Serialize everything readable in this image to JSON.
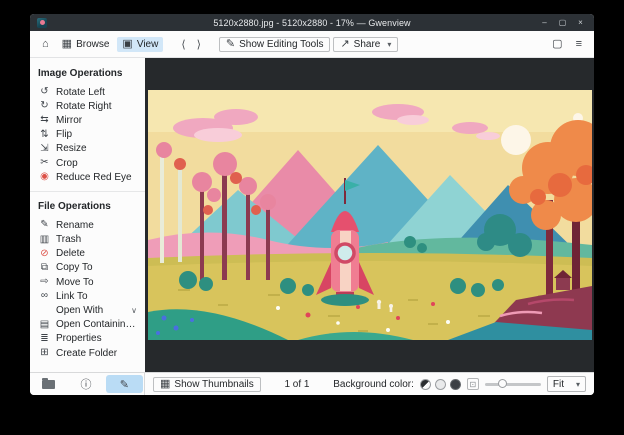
{
  "window": {
    "title": "5120x2880.jpg - 5120x2880 - 17% — Gwenview"
  },
  "icons": {
    "home": "⌂",
    "browse": "▦",
    "view": "▣",
    "back": "⟨",
    "forward": "⟩",
    "pencil": "✎",
    "share": "↗",
    "chevron_down": "▾",
    "fit_frame": "▢",
    "menu": "≡",
    "minimize": "–",
    "maximize": "▢",
    "close": "×",
    "rotate_left": "↺",
    "rotate_right": "↻",
    "mirror": "⇆",
    "flip": "⇅",
    "resize": "⇲",
    "crop": "✂",
    "red_eye": "◉",
    "rename": "✎",
    "trash": "▥",
    "delete": "⊘",
    "copy": "⧉",
    "move": "⇨",
    "link": "∞",
    "folder_open": "▤",
    "properties": "≣",
    "new_folder": "⊞",
    "expander": "∨",
    "info": "ⓘ",
    "thumbnails": "▦",
    "zoom_box": "⊡"
  },
  "toolbar": {
    "browse": "Browse",
    "view": "View",
    "show_editing_tools": "Show Editing Tools",
    "share": "Share"
  },
  "sidebar": {
    "image_operations": {
      "title": "Image Operations",
      "items": [
        {
          "label": "Rotate Left"
        },
        {
          "label": "Rotate Right"
        },
        {
          "label": "Mirror"
        },
        {
          "label": "Flip"
        },
        {
          "label": "Resize"
        },
        {
          "label": "Crop"
        },
        {
          "label": "Reduce Red Eye"
        }
      ]
    },
    "file_operations": {
      "title": "File Operations",
      "items": [
        {
          "label": "Rename"
        },
        {
          "label": "Trash"
        },
        {
          "label": "Delete"
        },
        {
          "label": "Copy To"
        },
        {
          "label": "Move To"
        },
        {
          "label": "Link To"
        },
        {
          "label": "Open With"
        },
        {
          "label": "Open Containing Folder"
        },
        {
          "label": "Properties"
        },
        {
          "label": "Create Folder"
        }
      ]
    }
  },
  "statusbar": {
    "show_thumbnails": "Show Thumbnails",
    "count": "1 of 1",
    "background_color_label": "Background color:",
    "fit": "Fit"
  },
  "colors": {
    "accent": "#3daee9",
    "titlebar_bg": "#2c3136",
    "chrome_bg": "#fcfcfc",
    "viewer_bg": "#26292c",
    "danger": "#da4453"
  }
}
